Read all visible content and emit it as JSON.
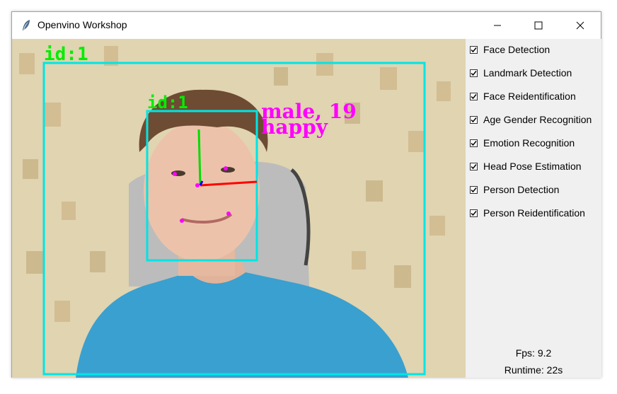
{
  "window": {
    "title": "Openvino Workshop",
    "app_icon": "feather-icon",
    "controls": [
      "minimize-icon",
      "maximize-icon",
      "close-icon"
    ]
  },
  "video": {
    "overlays": {
      "person_id_label": "id:1",
      "face_id_label": "id:1",
      "gender_age_label": "male, 19",
      "emotion_label": "happy"
    },
    "colors": {
      "box": "#00e5e5",
      "id_text": "#00ee00",
      "attr_text": "#ff00ff",
      "landmark": "#ff00ff",
      "axis_x": "#ff0000",
      "axis_y": "#00dd00",
      "axis_z": "#0000ff"
    }
  },
  "panel": {
    "checkboxes": [
      {
        "label": "Face Detection",
        "checked": true
      },
      {
        "label": "Landmark Detection",
        "checked": true
      },
      {
        "label": "Face Reidentification",
        "checked": true
      },
      {
        "label": "Age Gender Recognition",
        "checked": true
      },
      {
        "label": "Emotion Recognition",
        "checked": true
      },
      {
        "label": "Head Pose Estimation",
        "checked": true
      },
      {
        "label": "Person Detection",
        "checked": true
      },
      {
        "label": "Person Reidentification",
        "checked": true
      }
    ],
    "fps": "Fps: 9.2",
    "runtime": "Runtime: 22s"
  }
}
